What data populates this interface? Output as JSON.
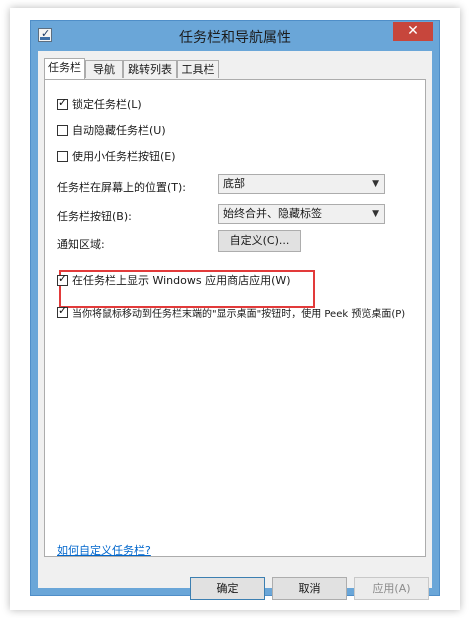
{
  "window": {
    "title": "任务栏和导航属性",
    "close_glyph": "✕"
  },
  "tabs": [
    {
      "label": "任务栏",
      "active": true
    },
    {
      "label": "导航",
      "active": false
    },
    {
      "label": "跳转列表",
      "active": false
    },
    {
      "label": "工具栏",
      "active": false
    }
  ],
  "taskbar": {
    "lock": {
      "label": "锁定任务栏(L)",
      "checked": true
    },
    "autohide": {
      "label": "自动隐藏任务栏(U)",
      "checked": false
    },
    "small_buttons": {
      "label": "使用小任务栏按钮(E)",
      "checked": false
    },
    "position": {
      "label": "任务栏在屏幕上的位置(T):",
      "value": "底部"
    },
    "buttons": {
      "label": "任务栏按钮(B):",
      "value": "始终合并、隐藏标签"
    },
    "notification": {
      "label": "通知区域:",
      "button": "自定义(C)..."
    },
    "store_apps": {
      "label": "在任务栏上显示 Windows 应用商店应用(W)",
      "checked": true
    },
    "peek": {
      "label": "当你将鼠标移动到任务栏末端的\"显示桌面\"按钮时，使用 Peek 预览桌面(P)",
      "checked": true
    },
    "help_link": "如何自定义任务栏?"
  },
  "footer": {
    "ok": "确定",
    "cancel": "取消",
    "apply": "应用(A)"
  },
  "colors": {
    "accent_frame": "#6aa6d8",
    "close": "#c7463c",
    "highlight": "#e23a3a",
    "link": "#0066cc"
  },
  "icons": {
    "window_icon": "taskbar-properties-icon",
    "select_arrow": "chevron-down-icon"
  }
}
